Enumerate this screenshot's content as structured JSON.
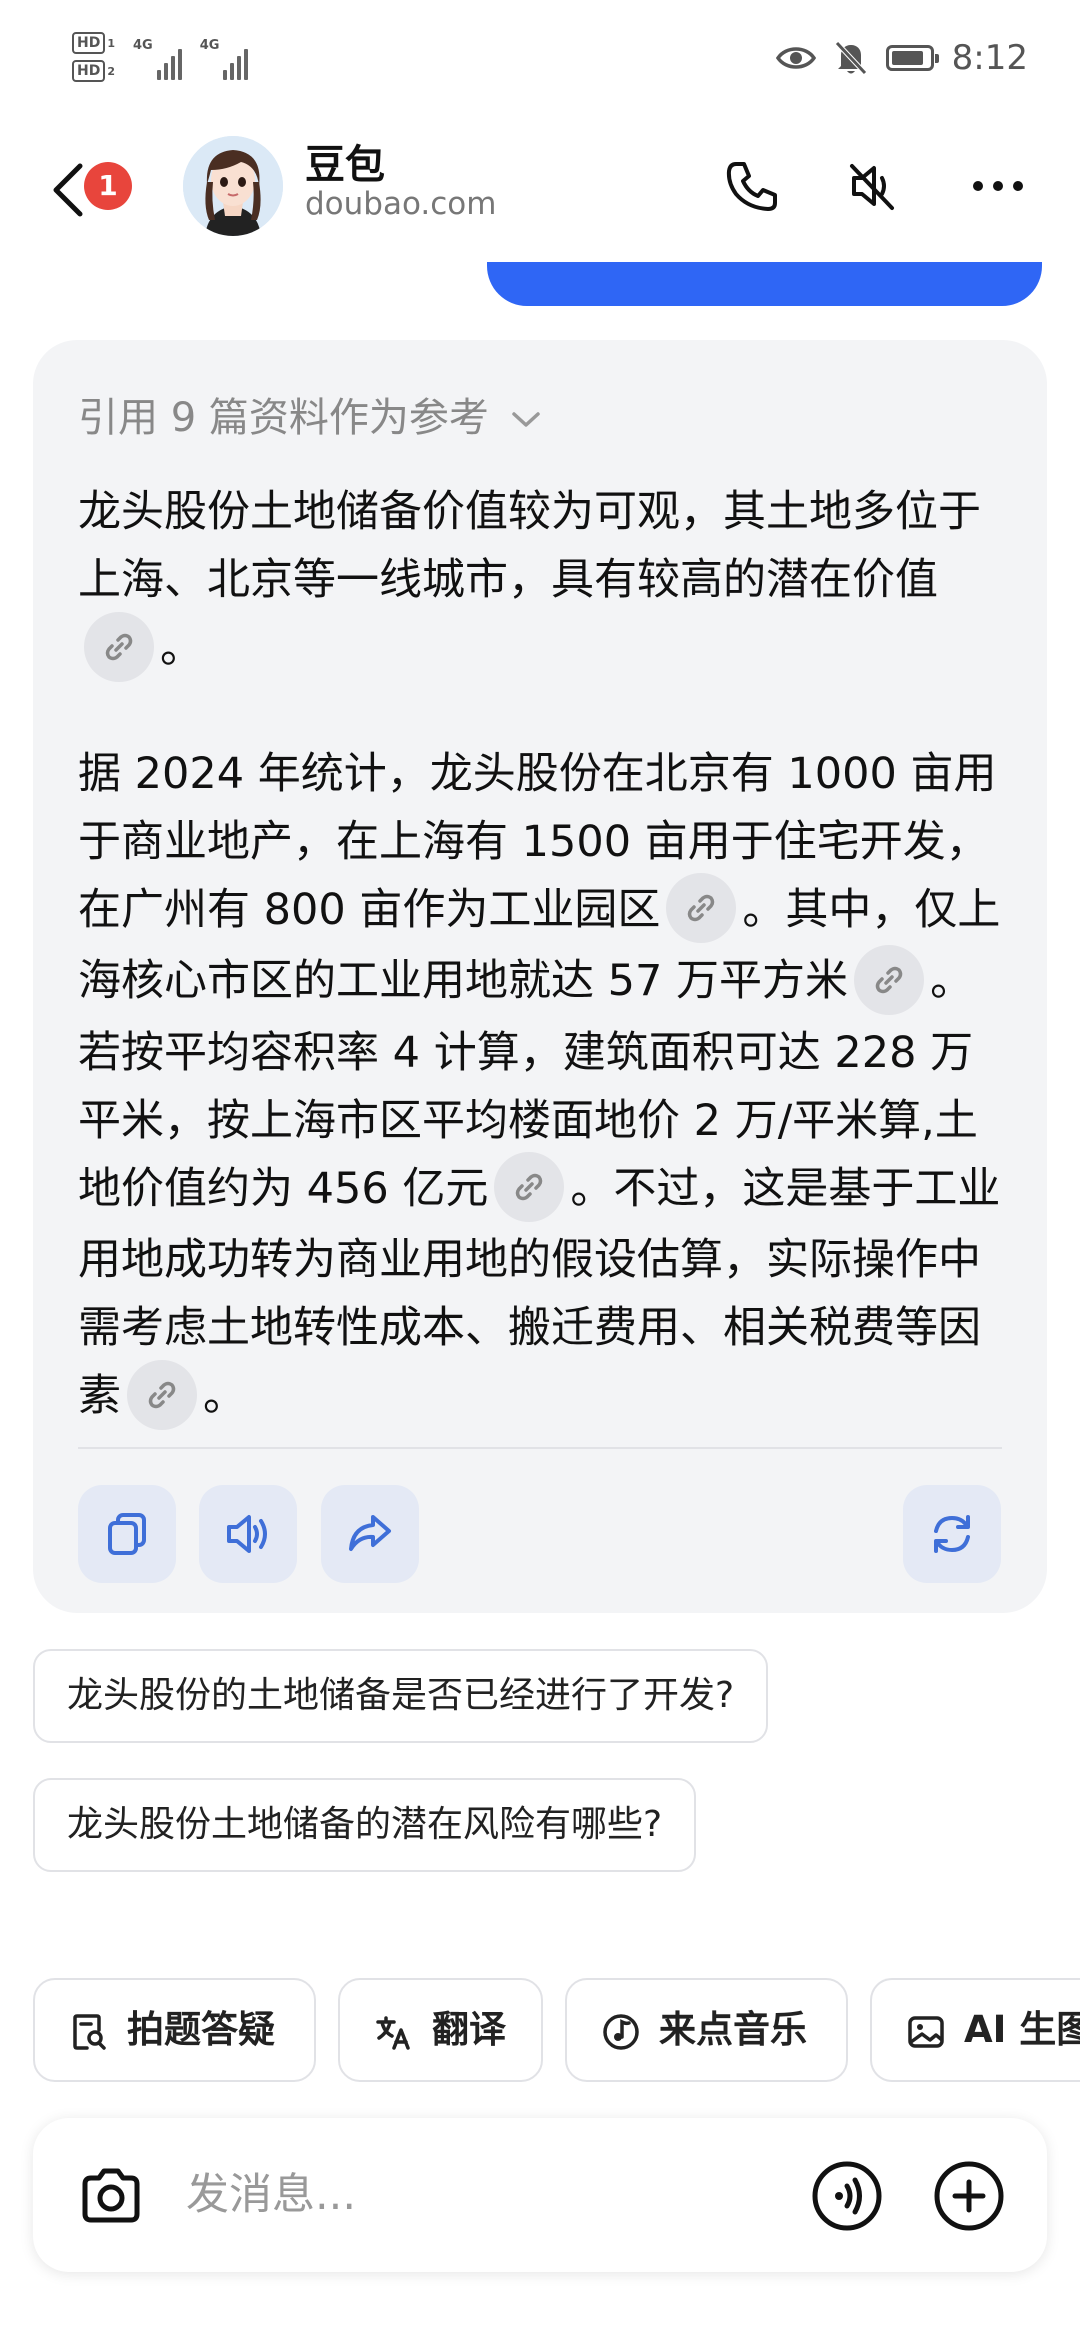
{
  "status_bar": {
    "sim1": "HD",
    "sim1_num": "1",
    "sim2": "HD",
    "sim2_num": "2",
    "net1": "4G",
    "net2": "4G",
    "time": "8:12",
    "battery_level": 0.85,
    "icons": [
      "eye-icon",
      "bell-mute-icon",
      "battery-icon"
    ]
  },
  "header": {
    "unread_count": "1",
    "title": "豆包",
    "subtitle": "doubao.com",
    "icons": [
      "back-icon",
      "avatar",
      "phone-icon",
      "speaker-mute-icon",
      "more-icon"
    ]
  },
  "answer": {
    "refs": "引用 9 篇资料作为参考",
    "para1": {
      "t1": "龙头股份土地储备价值较为可观，其土地多位于上海、北京等一线城市，具有较高的潜在价值",
      "t2": "。"
    },
    "para2": {
      "t1": "据 2024 年统计，龙头股份在北京有 1000 亩用于商业地产，在上海有 1500 亩用于住宅开发，在广州有 800 亩作为工业园区",
      "t2": "。其中，仅上海核心市区的工业用地就达 57 万平方米",
      "t3": "。若按平均容积率 4 计算，建筑面积可达 228 万平米，按上海市区平均楼面地价 2 万/平米算,土地价值约为 456 亿元",
      "t4": "。不过，这是基于工业用地成功转为商业用地的假设估算，实际操作中需考虑土地转性成本、搬迁费用、相关税费等因素",
      "t5": "。"
    },
    "actions": [
      "copy-icon",
      "speaker-icon",
      "share-icon",
      "regenerate-icon"
    ]
  },
  "suggestions": [
    "龙头股份的土地储备是否已经进行了开发?",
    "龙头股份土地储备的潜在风险有哪些?"
  ],
  "quick_chips": [
    {
      "label": "拍题答疑",
      "icon": "search-doc-icon"
    },
    {
      "label": "翻译",
      "icon": "translate-icon"
    },
    {
      "label": "来点音乐",
      "icon": "music-icon"
    },
    {
      "label": "AI 生图",
      "icon": "image-icon"
    }
  ],
  "input": {
    "placeholder": "发消息...",
    "icons": [
      "camera-icon",
      "voice-icon",
      "plus-icon"
    ]
  },
  "colors": {
    "accent": "#2f66f5",
    "badge": "#e8453c",
    "card_bg": "#f3f4f6",
    "action_icon": "#3f6fd8"
  }
}
